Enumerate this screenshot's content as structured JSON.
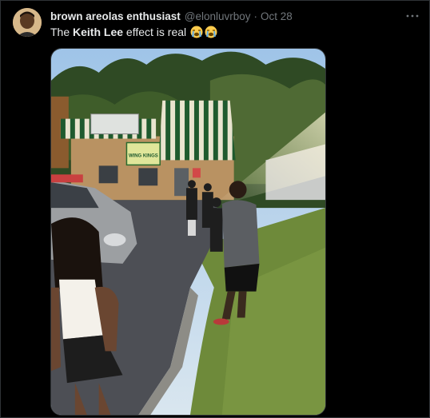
{
  "tweet": {
    "author_name": "brown areolas enthusiast",
    "handle": "@elonluvrboy",
    "separator": "·",
    "date": "Oct 28",
    "text_prefix": "The ",
    "text_bold": "Keith Lee",
    "text_suffix": " effect is real",
    "emojis": [
      "loudly-crying-face",
      "loudly-crying-face"
    ]
  },
  "media": {
    "sign_text": "WING KINGS"
  },
  "icons": {
    "more": "more-dots-icon",
    "avatar": "avatar"
  }
}
